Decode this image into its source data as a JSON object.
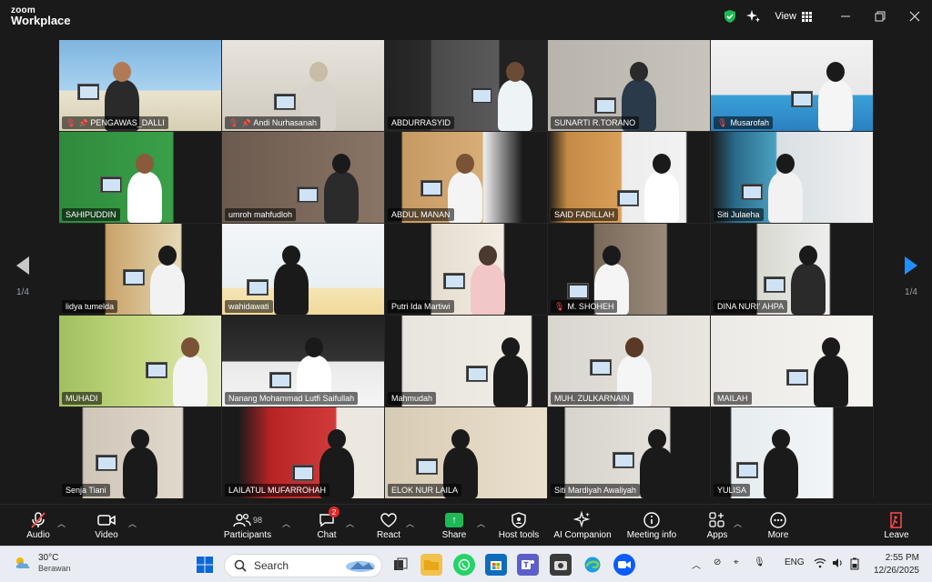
{
  "app": {
    "logo_line1": "zoom",
    "logo_line2": "Workplace",
    "view_label": "View"
  },
  "colors": {
    "active_speaker": "#2fbd6a",
    "muted": "#ff4b4b",
    "share": "#1db954",
    "page_arrow": "#1e90ff"
  },
  "pagination": {
    "left": "1/4",
    "right": "1/4"
  },
  "participants": [
    {
      "name": "PENGAWAS_DALLI",
      "muted": true,
      "pinned": true
    },
    {
      "name": "Andi Nurhasanah",
      "muted": true,
      "pinned": true
    },
    {
      "name": "ABDURRASYID",
      "muted": false,
      "active": true
    },
    {
      "name": "SUNARTI R.TORANO",
      "muted": false
    },
    {
      "name": "Musarofah",
      "muted": true
    },
    {
      "name": "SAHIPUDDIN",
      "muted": false
    },
    {
      "name": "umroh mahfudloh",
      "muted": false
    },
    {
      "name": "ABDUL MANAN",
      "muted": false
    },
    {
      "name": "SAID FADILLAH",
      "muted": false
    },
    {
      "name": "Siti Julaeha",
      "muted": false
    },
    {
      "name": "lidya tumelda",
      "muted": false
    },
    {
      "name": "wahidawati",
      "muted": false
    },
    {
      "name": "Putri Ida Martiwi",
      "muted": false
    },
    {
      "name": "M. SHOHEH",
      "muted": true
    },
    {
      "name": "DINA NURI' AHPA",
      "muted": false
    },
    {
      "name": "MUHADI",
      "muted": false
    },
    {
      "name": "Nanang Mohammad Lutfi Saifullah",
      "muted": false
    },
    {
      "name": "Mahmudah",
      "muted": false
    },
    {
      "name": "MUH. ZULKARNAIN",
      "muted": false
    },
    {
      "name": "MAILAH",
      "muted": false
    },
    {
      "name": "Senja Tiani",
      "muted": false
    },
    {
      "name": "LAILATUL MUFARROHAH",
      "muted": false
    },
    {
      "name": "ELOK NUR LAILA",
      "muted": false
    },
    {
      "name": "Siti Mardiyah Awaliyah",
      "muted": false
    },
    {
      "name": "YULISA",
      "muted": false
    }
  ],
  "toolbar": {
    "audio": "Audio",
    "video": "Video",
    "participants": "Participants",
    "participants_count": "98",
    "chat": "Chat",
    "chat_badge": "2",
    "react": "React",
    "share": "Share",
    "host_tools": "Host tools",
    "ai_companion": "AI Companion",
    "meeting_info": "Meeting info",
    "apps": "Apps",
    "more": "More",
    "leave": "Leave"
  },
  "taskbar": {
    "temperature": "30°C",
    "weather_desc": "Berawan",
    "search_placeholder": "Search",
    "language": "ENG",
    "time": "2:55 PM",
    "date": "12/26/2025"
  }
}
